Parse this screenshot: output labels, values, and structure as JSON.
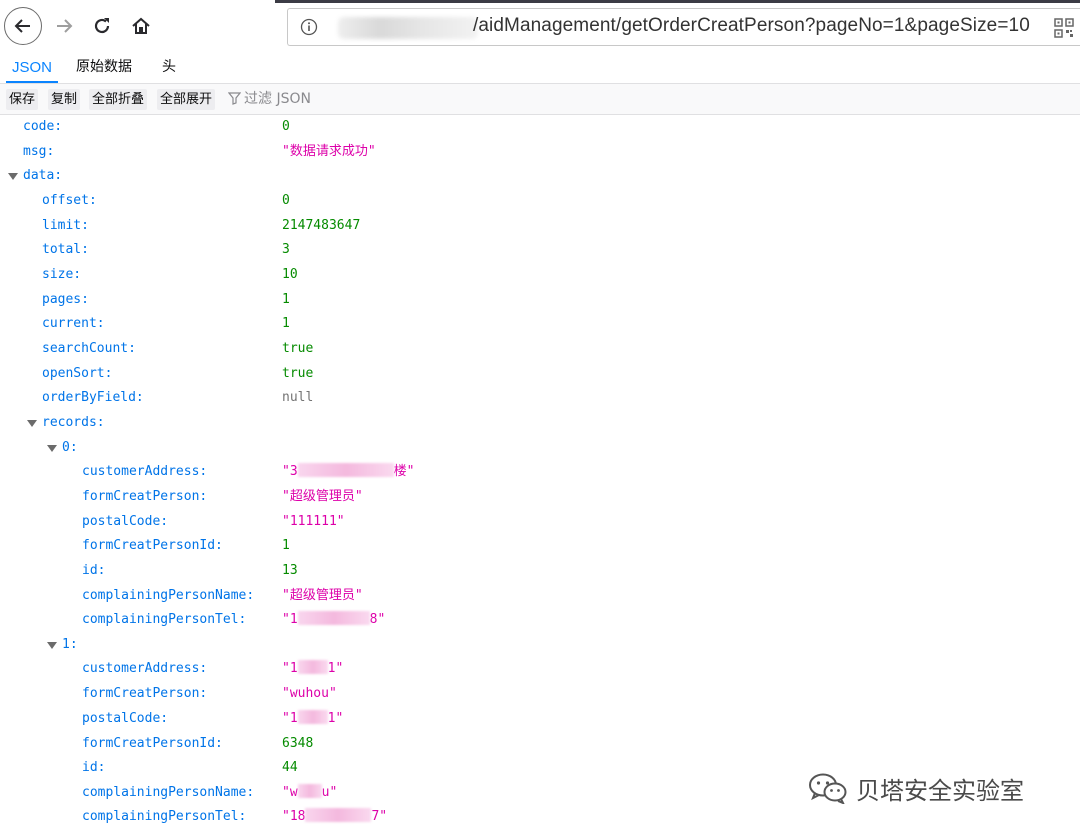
{
  "browser": {
    "url_visible": "/aidManagement/getOrderCreatPerson?pageNo=1&pageSize=10"
  },
  "viewer": {
    "tabs": [
      {
        "label": "JSON",
        "active": true
      },
      {
        "label": "原始数据",
        "active": false
      },
      {
        "label": "头",
        "active": false
      }
    ],
    "toolbar": {
      "save": "保存",
      "copy": "复制",
      "collapse_all": "全部折叠",
      "expand_all": "全部展开",
      "filter_placeholder": "过滤 JSON"
    }
  },
  "tree": {
    "code": {
      "key": "code:",
      "value": "0"
    },
    "msg": {
      "key": "msg:",
      "value": "\"数据请求成功\""
    },
    "data": {
      "key": "data:"
    },
    "offset": {
      "key": "offset:",
      "value": "0"
    },
    "limit": {
      "key": "limit:",
      "value": "2147483647"
    },
    "total": {
      "key": "total:",
      "value": "3"
    },
    "size": {
      "key": "size:",
      "value": "10"
    },
    "pages": {
      "key": "pages:",
      "value": "1"
    },
    "current": {
      "key": "current:",
      "value": "1"
    },
    "searchCount": {
      "key": "searchCount:",
      "value": "true"
    },
    "openSort": {
      "key": "openSort:",
      "value": "true"
    },
    "orderByField": {
      "key": "orderByField:",
      "value": "null"
    },
    "records": {
      "key": "records:"
    },
    "r0": {
      "index": "0:",
      "customerAddress": {
        "key": "customerAddress:",
        "pre": "\"3",
        "post": "楼\""
      },
      "formCreatPerson": {
        "key": "formCreatPerson:",
        "value": "\"超级管理员\""
      },
      "postalCode": {
        "key": "postalCode:",
        "value": "\"111111\""
      },
      "formCreatPersonId": {
        "key": "formCreatPersonId:",
        "value": "1"
      },
      "id": {
        "key": "id:",
        "value": "13"
      },
      "complainingPersonName": {
        "key": "complainingPersonName:",
        "value": "\"超级管理员\""
      },
      "complainingPersonTel": {
        "key": "complainingPersonTel:",
        "pre": "\"1",
        "post": "8\""
      }
    },
    "r1": {
      "index": "1:",
      "customerAddress": {
        "key": "customerAddress:",
        "pre": "\"1",
        "post": "1\""
      },
      "formCreatPerson": {
        "key": "formCreatPerson:",
        "value": "\"wuhou\""
      },
      "postalCode": {
        "key": "postalCode:",
        "pre": "\"1",
        "post": "1\""
      },
      "formCreatPersonId": {
        "key": "formCreatPersonId:",
        "value": "6348"
      },
      "id": {
        "key": "id:",
        "value": "44"
      },
      "complainingPersonName": {
        "key": "complainingPersonName:",
        "pre": "\"w",
        "post": "u\""
      },
      "complainingPersonTel": {
        "key": "complainingPersonTel:",
        "pre": "\"18",
        "post": "7\""
      }
    }
  },
  "watermark": {
    "text": "贝塔安全实验室"
  }
}
